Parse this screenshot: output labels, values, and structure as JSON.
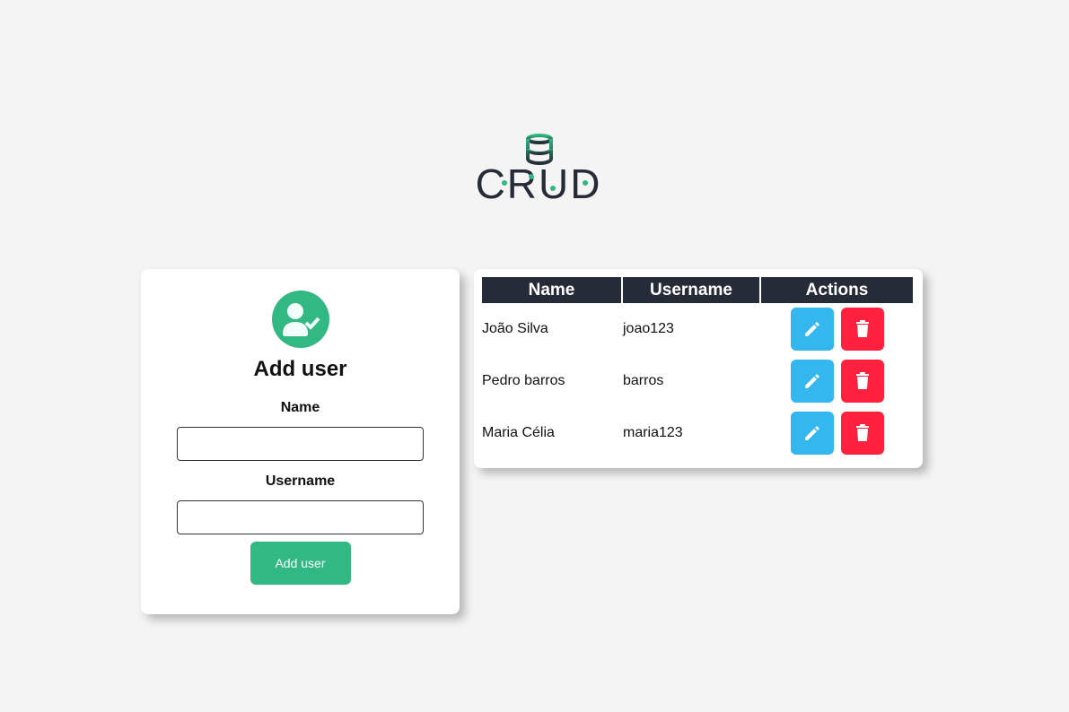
{
  "logo": {
    "text": "CRUD"
  },
  "form": {
    "title": "Add user",
    "name_label": "Name",
    "name_value": "",
    "name_placeholder": "",
    "username_label": "Username",
    "username_value": "",
    "username_placeholder": "",
    "submit_label": "Add user"
  },
  "table": {
    "headers": [
      "Name",
      "Username",
      "Actions"
    ],
    "rows": [
      {
        "name": "João Silva",
        "username": "joao123"
      },
      {
        "name": "Pedro barros",
        "username": "barros"
      },
      {
        "name": "Maria Célia",
        "username": "maria123"
      }
    ]
  },
  "colors": {
    "accent": "#31b883",
    "dark": "#252c38",
    "edit": "#33b7ee",
    "delete": "#ff213e"
  }
}
